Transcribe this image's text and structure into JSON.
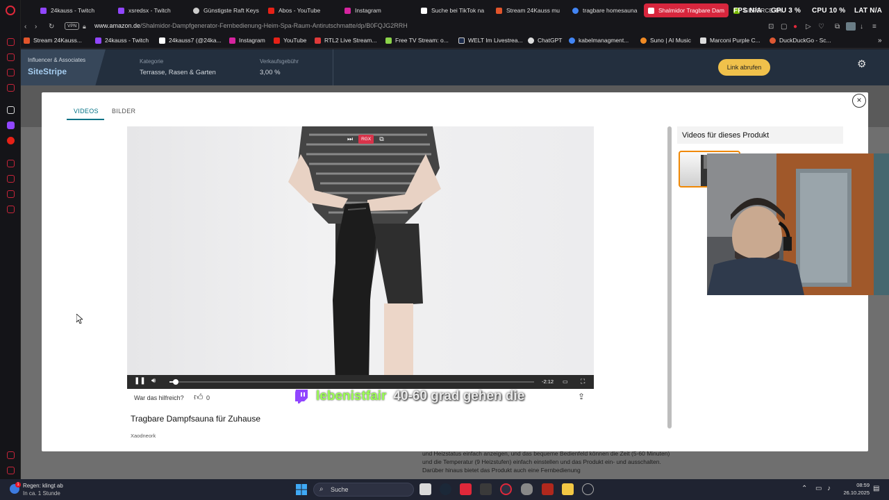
{
  "browser": {
    "tabs": [
      {
        "label": "24kauss - Twitch",
        "icon": "twitch-icon",
        "color": "#9146ff"
      },
      {
        "label": "xsredsx - Twitch",
        "icon": "twitch-icon",
        "color": "#9146ff"
      },
      {
        "label": "Günstigste Raft Keys",
        "icon": "gear-icon",
        "color": "#cccccc"
      },
      {
        "label": "Abos - YouTube",
        "icon": "youtube-icon",
        "color": "#e62117"
      },
      {
        "label": "Instagram",
        "icon": "instagram-icon",
        "color": "#d6249f"
      },
      {
        "label": "Suche bei TikTok na",
        "icon": "tiktok-icon",
        "color": "#ffffff"
      },
      {
        "label": "Stream 24Kauss mu",
        "icon": "stream-icon",
        "color": "#e2552b"
      },
      {
        "label": "tragbare homesauna",
        "icon": "google-icon",
        "color": "#4285f4"
      },
      {
        "label": "Shalmidor Tragbare Dam",
        "icon": "amazon-icon",
        "color": "#ffffff"
      },
      {
        "label": "GEFORCE Treiber",
        "icon": "nvidia-icon",
        "color": "#76b900"
      }
    ],
    "perf": {
      "fps": "FPS N/A",
      "gpu": "GPU 3 %",
      "cpu": "CPU 10 %",
      "lat": "LAT N/A"
    },
    "vpn_label": "VPN",
    "url_domain": "www.amazon.de",
    "url_path": "/Shalmidor-Dampfgenerator-Fernbedienung-Heim-Spa-Raum-Antirutschmatte/dp/B0FQJG2RRH",
    "bookmarks": [
      {
        "label": "Stream 24Kauss...",
        "icon": "stream-icon",
        "color": "#e2552b"
      },
      {
        "label": "24kauss - Twitch",
        "icon": "twitch-icon",
        "color": "#9146ff"
      },
      {
        "label": "24kauss7 (@24ka...",
        "icon": "tiktok-icon",
        "color": "#ffffff"
      },
      {
        "label": "Instagram",
        "icon": "instagram-icon",
        "color": "#d6249f"
      },
      {
        "label": "YouTube",
        "icon": "youtube-icon",
        "color": "#e62117"
      },
      {
        "label": "RTL2 Live Stream...",
        "icon": "rtl2-icon",
        "color": "#e03a3a"
      },
      {
        "label": "Free TV Stream: o...",
        "icon": "tv-icon",
        "color": "#8bd34a"
      },
      {
        "label": "WELT Im Livestrea...",
        "icon": "welt-icon",
        "color": "#1b2a4a"
      },
      {
        "label": "ChatGPT",
        "icon": "chatgpt-icon",
        "color": "#dddddd"
      },
      {
        "label": "kabelmanagment...",
        "icon": "google-icon",
        "color": "#4285f4"
      },
      {
        "label": "Suno | AI Music",
        "icon": "suno-icon",
        "color": "#f08a24"
      },
      {
        "label": "Marconi Purple C...",
        "icon": "document-icon",
        "color": "#dddddd"
      },
      {
        "label": "DuckDuckGo - Sc...",
        "icon": "duckduckgo-icon",
        "color": "#de5833"
      }
    ]
  },
  "sitestripe": {
    "brand_small": "Influencer & Associates",
    "brand_big": "SiteStripe",
    "category_label": "Kategorie",
    "category_value": "Terrasse, Rasen & Garten",
    "fee_label": "Verkaufsgebühr",
    "fee_value": "3,00 %",
    "link_button": "Link abrufen"
  },
  "modal": {
    "tabs": [
      "VIDEOS",
      "BILDER"
    ],
    "active_tab": "VIDEOS",
    "close_label": "×",
    "video": {
      "overlay_badge": "RGX",
      "time_remaining": "-2:12",
      "progress": 0.017,
      "playing": true
    },
    "helpful_label": "War das hilfreich?",
    "helpful_count": "0",
    "video_title": "Tragbare Dampfsauna für Zuhause",
    "video_author": "Xaodneork",
    "related_title": "Videos für dieses Produkt"
  },
  "page_text": "und Heizstatus einfach anzeigen, und das bequeme Bedienfeld können die Zeit (5-60 Minuten) und die Temperatur (9 Heizstufen) einfach einstellen und das Produkt ein- und ausschalten. Darüber hinaus bietet das Produkt auch eine Fernbedienung",
  "twitch_chat": {
    "username": "lebenistfair",
    "message": "40-60 grad gehen die"
  },
  "taskbar": {
    "weather_line1": "Regen: klingt ab",
    "weather_line2": "In ca. 1 Stunde",
    "weather_badge": "1",
    "search_label": "Suche",
    "time": "08:59",
    "date": "26.10.2025"
  },
  "colors": {
    "accent_teal": "#007185",
    "sitestripe_bg": "#232f3e",
    "link_button": "#f0c14b",
    "thumb_border": "#f08804",
    "twitch_user": "#9bff54",
    "opera_red": "#e0283a"
  }
}
